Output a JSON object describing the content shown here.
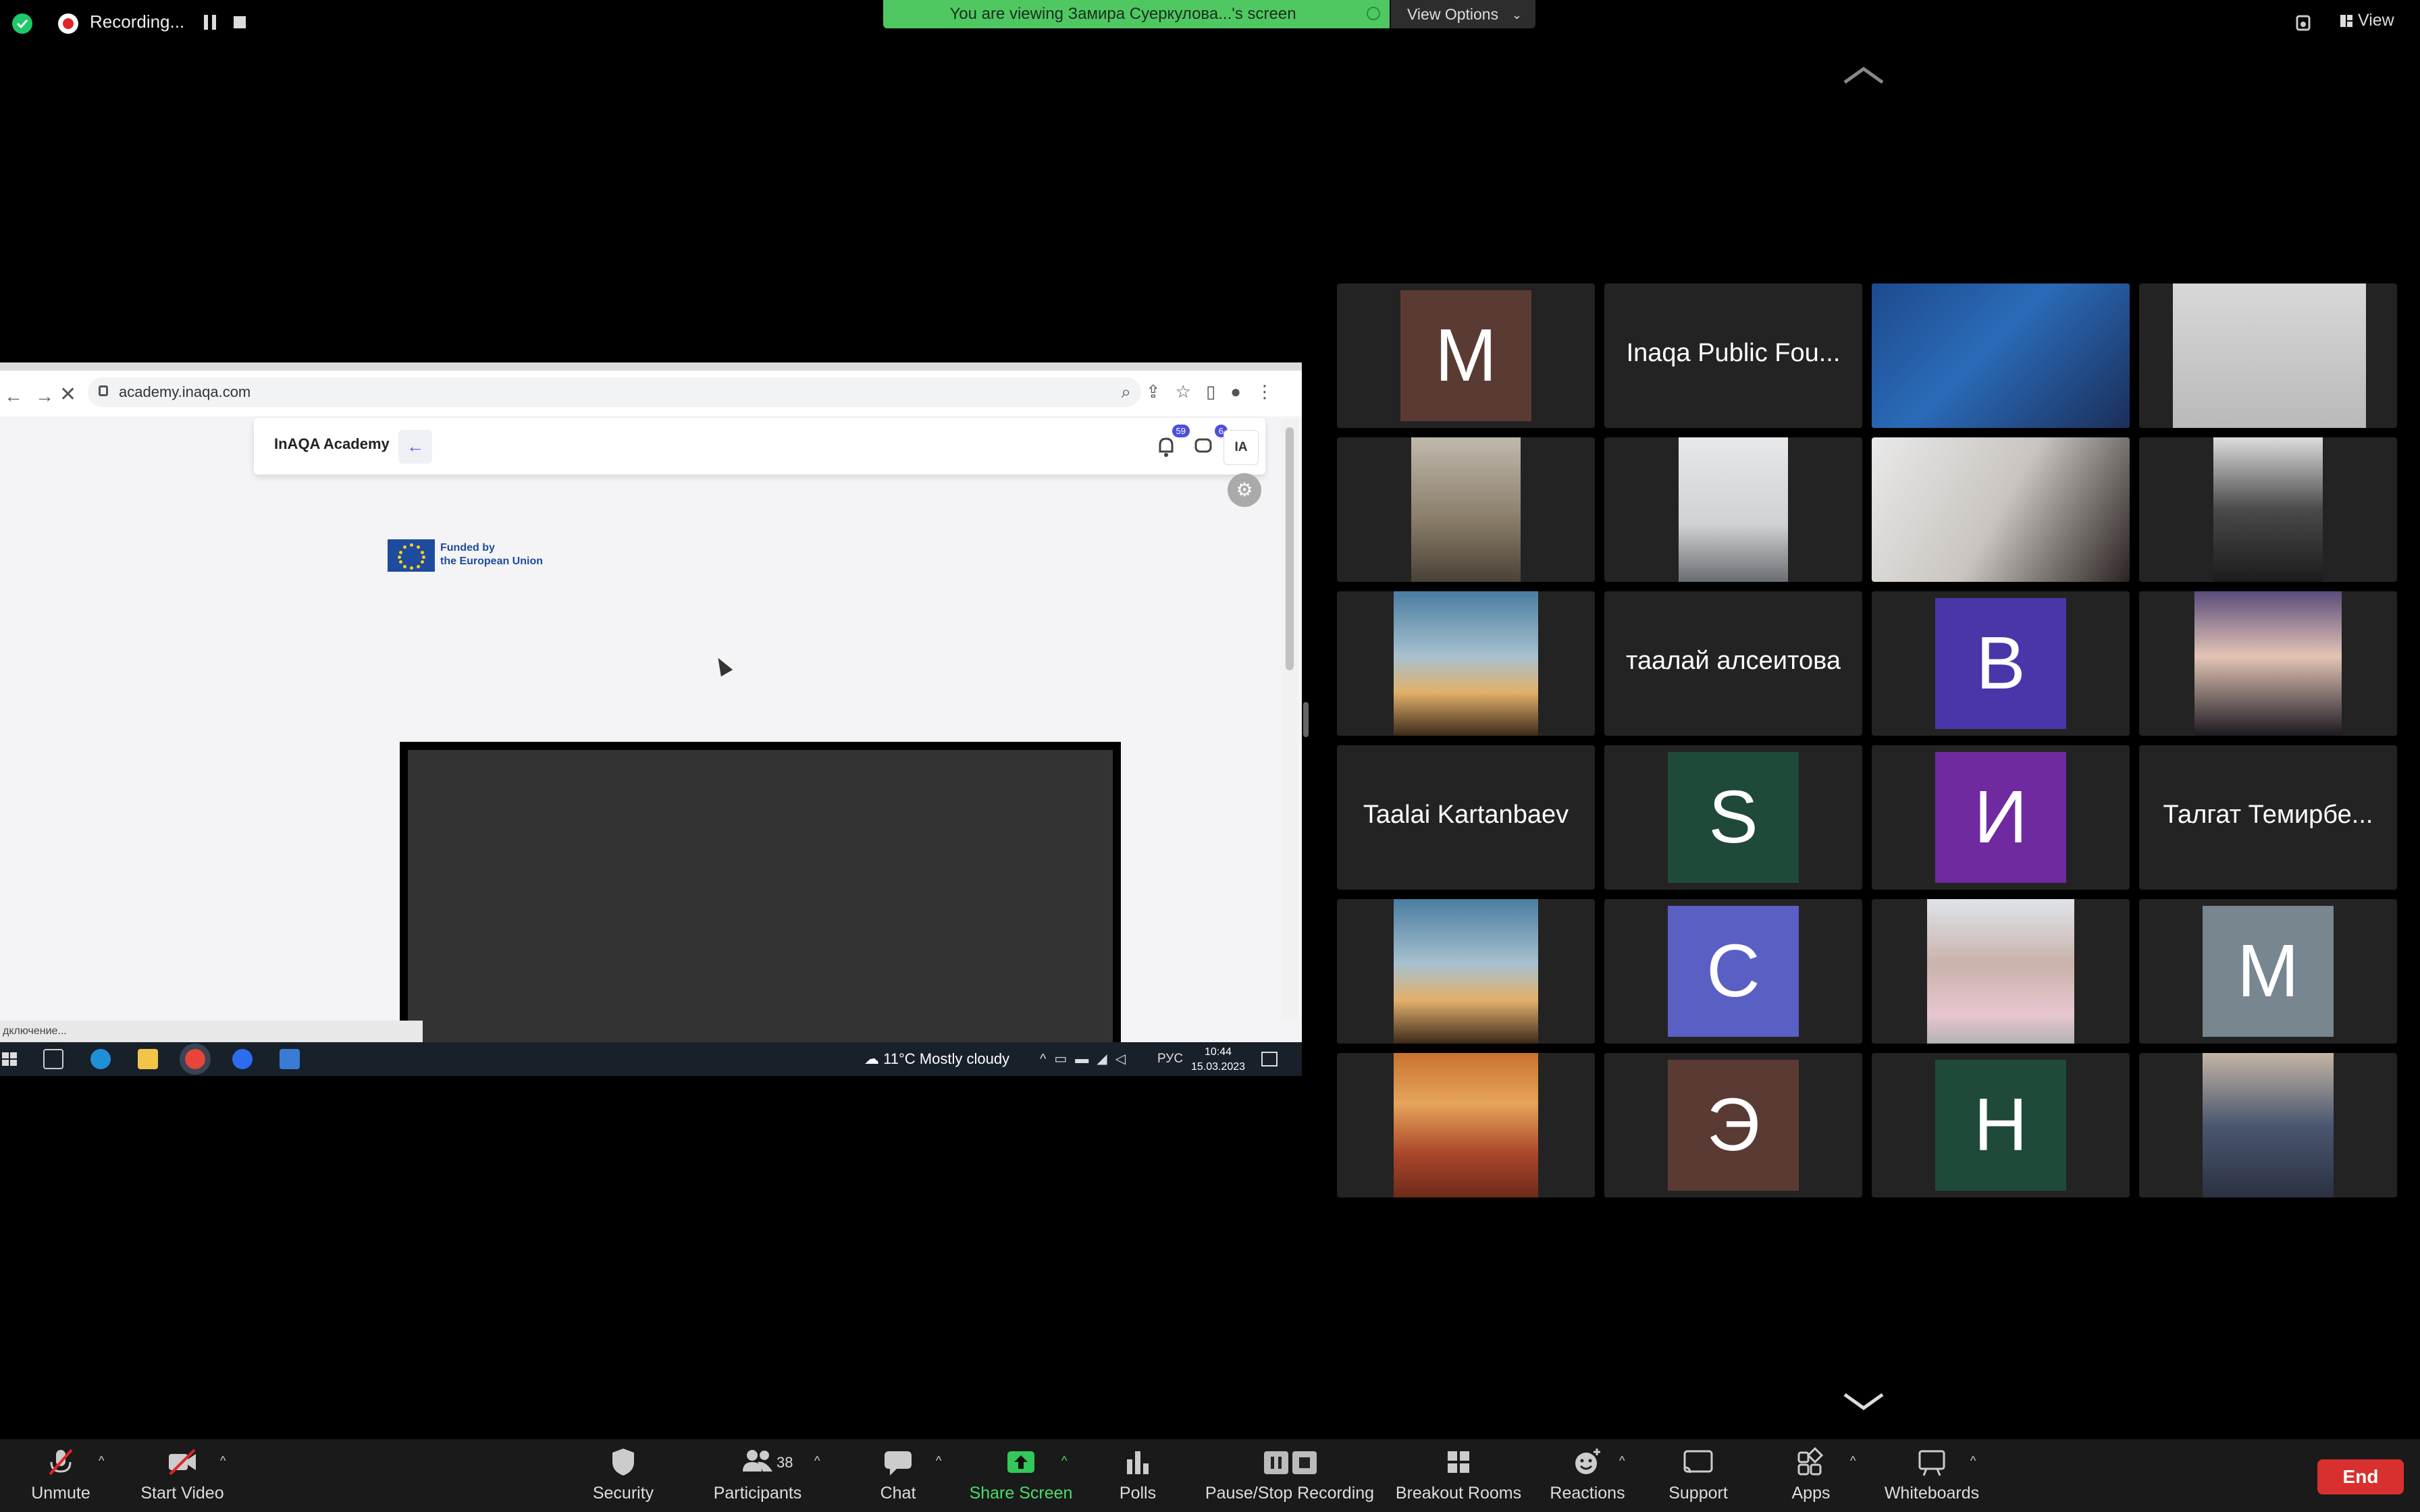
{
  "topbar": {
    "recording_label": "Recording...",
    "viewing_banner": "You are viewing Замира Суеркулова...'s screen",
    "view_options_label": "View Options",
    "view_label": "View"
  },
  "shared_screen": {
    "url": "academy.inaqa.com",
    "app_title": "InAQA Academy",
    "notification_count": "59",
    "message_count": "6",
    "user_initials": "IA",
    "eu_line1": "Funded by",
    "eu_line2": "the European Union",
    "status_tip": "дключение...",
    "taskbar": {
      "temperature": "11°C",
      "weather": "Mostly cloudy",
      "language": "РУС",
      "time": "10:44",
      "date": "15.03.2023"
    }
  },
  "gallery": {
    "tiles": [
      {
        "kind": "letter",
        "text": "M",
        "color": "#5a3b33"
      },
      {
        "kind": "name",
        "text": "Inaqa Public Fou..."
      },
      {
        "kind": "photo",
        "desc": "presenter-slide",
        "active": true
      },
      {
        "kind": "photo",
        "desc": "blurred"
      },
      {
        "kind": "photo",
        "desc": "man-with-plants"
      },
      {
        "kind": "photo",
        "desc": "man-ceiling"
      },
      {
        "kind": "photo",
        "desc": "woman-laptop"
      },
      {
        "kind": "photo",
        "desc": "dark-object"
      },
      {
        "kind": "photo",
        "desc": "quote-landscape"
      },
      {
        "kind": "name",
        "text": "таалай алсеитова"
      },
      {
        "kind": "letter",
        "text": "B",
        "color": "#4a36a8"
      },
      {
        "kind": "photo",
        "desc": "woman-portrait"
      },
      {
        "kind": "name",
        "text": "Taalai Kartanbaev"
      },
      {
        "kind": "letter",
        "text": "S",
        "color": "#1f4a3a"
      },
      {
        "kind": "letter",
        "text": "И",
        "color": "#6f2aa0"
      },
      {
        "kind": "name",
        "text": "Талгат Темирбе..."
      },
      {
        "kind": "photo",
        "desc": "quote-landscape"
      },
      {
        "kind": "letter",
        "text": "C",
        "color": "#5a5fc4"
      },
      {
        "kind": "photo",
        "desc": "woman-glasses"
      },
      {
        "kind": "letter",
        "text": "M",
        "color": "#77868f"
      },
      {
        "kind": "photo",
        "desc": "desert"
      },
      {
        "kind": "letter",
        "text": "Э",
        "color": "#5a3b33"
      },
      {
        "kind": "letter",
        "text": "H",
        "color": "#1f4a3a"
      },
      {
        "kind": "photo",
        "desc": "two-men"
      }
    ]
  },
  "toolbar": {
    "unmute": "Unmute",
    "start_video": "Start Video",
    "security": "Security",
    "participants": "Participants",
    "participants_count": "38",
    "chat": "Chat",
    "share_screen": "Share Screen",
    "polls": "Polls",
    "pause_stop_recording": "Pause/Stop Recording",
    "breakout_rooms": "Breakout Rooms",
    "reactions": "Reactions",
    "support": "Support",
    "apps": "Apps",
    "whiteboards": "Whiteboards",
    "end": "End"
  },
  "colors": {
    "accent_green": "#4cdc6b",
    "end_red": "#d8302f",
    "tile_bg": "#232323"
  }
}
